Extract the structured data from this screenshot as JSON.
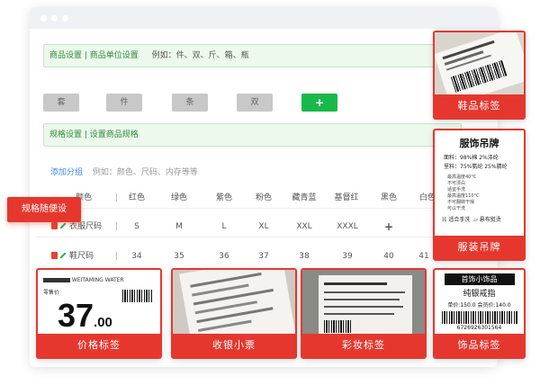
{
  "settings": {
    "unit_bar": {
      "title": "商品设置 | 商品单位设置",
      "hint": "例如：件、双、斤、箱、瓶"
    },
    "units": [
      "套",
      "件",
      "条",
      "双"
    ],
    "spec_bar": {
      "title": "规格设置 | 设置商品规格"
    },
    "add_group": {
      "label": "添加分组",
      "hint": "例如：颜色、尺码、内存等等"
    }
  },
  "badge": {
    "label": "规格随便设"
  },
  "color_row": {
    "label": "颜色",
    "values": [
      "红色",
      "绿色",
      "紫色",
      "粉色",
      "藏青蓝",
      "基督红",
      "黑色",
      "白色"
    ]
  },
  "size_row": {
    "label": "衣服尺码",
    "values": [
      "S",
      "M",
      "L",
      "XL",
      "XXL",
      "XXXL"
    ]
  },
  "shoe_row": {
    "label": "鞋尺码",
    "values": [
      "34",
      "35",
      "36",
      "37",
      "38",
      "39",
      "40",
      "41"
    ]
  },
  "cards": {
    "shoe": {
      "caption": "鞋品标签"
    },
    "clothing": {
      "caption": "服装吊牌",
      "title": "服饰吊牌",
      "fabric": "面料：98%棉  2%涤纶",
      "lining": "里料：75%氨纶  25%腈纶",
      "care": [
        "最高温度40°C",
        "不可漂白",
        "适宜手洗",
        "最高温度110°C",
        "不可翻转干燥",
        "可以干洗"
      ],
      "icon_labels": [
        "适合手洗",
        "悬布熨烫"
      ]
    },
    "price": {
      "caption": "价格标签",
      "top": "WEITAMING WATER",
      "label": "零售价",
      "integer": "37",
      "decimal": ".00"
    },
    "receipt": {
      "caption": "收银小票"
    },
    "cosmetic": {
      "caption": "彩妆标签"
    },
    "ornament": {
      "caption": "饰品标签",
      "head": "首饰小饰品",
      "name": "纯银戒指",
      "price": "单价:150.0  会员价:140.0",
      "number": "6726926301564"
    }
  }
}
